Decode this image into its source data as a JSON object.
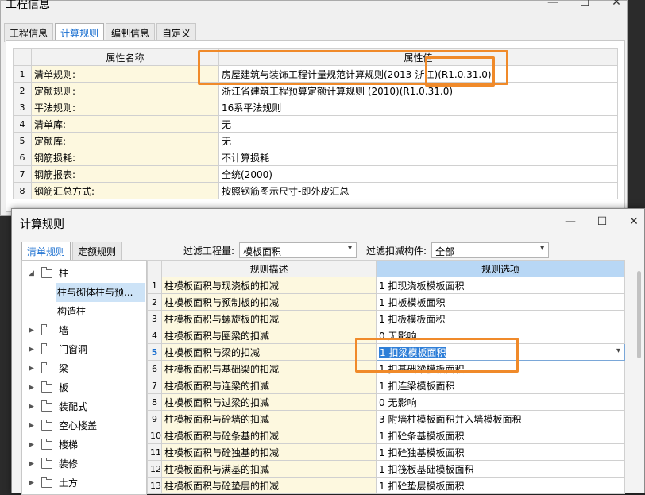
{
  "project_window": {
    "title": "工程信息",
    "tabs": [
      "工程信息",
      "计算规则",
      "编制信息",
      "自定义"
    ],
    "active_tab": 1,
    "columns": [
      "属性名称",
      "属性值"
    ],
    "rows": [
      {
        "num": "1",
        "name": "清单规则:",
        "value": "房屋建筑与装饰工程计量规范计算规则(2013-浙江)(R1.0.31.0)"
      },
      {
        "num": "2",
        "name": "定额规则:",
        "value": "浙江省建筑工程预算定额计算规则 (2010)(R1.0.31.0)"
      },
      {
        "num": "3",
        "name": "平法规则:",
        "value": "16系平法规则"
      },
      {
        "num": "4",
        "name": "清单库:",
        "value": "无"
      },
      {
        "num": "5",
        "name": "定额库:",
        "value": "无"
      },
      {
        "num": "6",
        "name": "钢筋损耗:",
        "value": "不计算损耗"
      },
      {
        "num": "7",
        "name": "钢筋报表:",
        "value": "全统(2000)"
      },
      {
        "num": "8",
        "name": "钢筋汇总方式:",
        "value": "按照钢筋图示尺寸-即外皮汇总"
      }
    ]
  },
  "rules_window": {
    "title": "计算规则",
    "tabs": [
      "清单规则",
      "定额规则"
    ],
    "active_tab": 0,
    "filter_qty_label": "过滤工程量:",
    "filter_qty_value": "模板面积",
    "filter_comp_label": "过滤扣减构件:",
    "filter_comp_value": "全部",
    "tree": [
      {
        "label": "柱",
        "level": 0,
        "expanded": true
      },
      {
        "label": "柱与砌体柱与预...",
        "level": 1,
        "selected": true
      },
      {
        "label": "构造柱",
        "level": 1
      },
      {
        "label": "墙",
        "level": 0
      },
      {
        "label": "门窗洞",
        "level": 0
      },
      {
        "label": "梁",
        "level": 0
      },
      {
        "label": "板",
        "level": 0
      },
      {
        "label": "装配式",
        "level": 0
      },
      {
        "label": "空心楼盖",
        "level": 0
      },
      {
        "label": "楼梯",
        "level": 0
      },
      {
        "label": "装修",
        "level": 0
      },
      {
        "label": "土方",
        "level": 0
      }
    ],
    "columns": [
      "规则描述",
      "规则选项"
    ],
    "rows": [
      {
        "num": "1",
        "desc": "柱模板面积与现浇板的扣减",
        "option": "1 扣现浇板模板面积"
      },
      {
        "num": "2",
        "desc": "柱模板面积与预制板的扣减",
        "option": "1 扣板模板面积"
      },
      {
        "num": "3",
        "desc": "柱模板面积与螺旋板的扣减",
        "option": "1 扣板模板面积"
      },
      {
        "num": "4",
        "desc": "柱模板面积与圈梁的扣减",
        "option": "0 无影响"
      },
      {
        "num": "5",
        "desc": "柱模板面积与梁的扣减",
        "option": "1 扣梁模板面积"
      },
      {
        "num": "6",
        "desc": "柱模板面积与基础梁的扣减",
        "option": "1 扣基础梁模板面积"
      },
      {
        "num": "7",
        "desc": "柱模板面积与连梁的扣减",
        "option": "1 扣连梁模板面积"
      },
      {
        "num": "8",
        "desc": "柱模板面积与过梁的扣减",
        "option": "0 无影响"
      },
      {
        "num": "9",
        "desc": "柱模板面积与砼墙的扣减",
        "option": "3 附墙柱模板面积并入墙模板面积"
      },
      {
        "num": "10",
        "desc": "柱模板面积与砼条基的扣减",
        "option": "1 扣砼条基模板面积"
      },
      {
        "num": "11",
        "desc": "柱模板面积与砼独基的扣减",
        "option": "1 扣砼独基模板面积"
      },
      {
        "num": "12",
        "desc": "柱模板面积与满基的扣减",
        "option": "1 扣筏板基础模板面积"
      },
      {
        "num": "13",
        "desc": "柱模板面积与砼垫层的扣减",
        "option": "1 扣砼垫层模板面积"
      }
    ],
    "selected_row": 4
  },
  "icons": {
    "minimize": "minimize-icon",
    "maximize": "maximize-icon",
    "close": "close-icon",
    "folder": "folder-icon",
    "chevron": "chevron-down-icon"
  },
  "colors": {
    "accent": "#1a6fd0",
    "highlight": "#f08a2a",
    "name_bg": "#fdf8df",
    "header_selected": "#b8d7f5"
  }
}
